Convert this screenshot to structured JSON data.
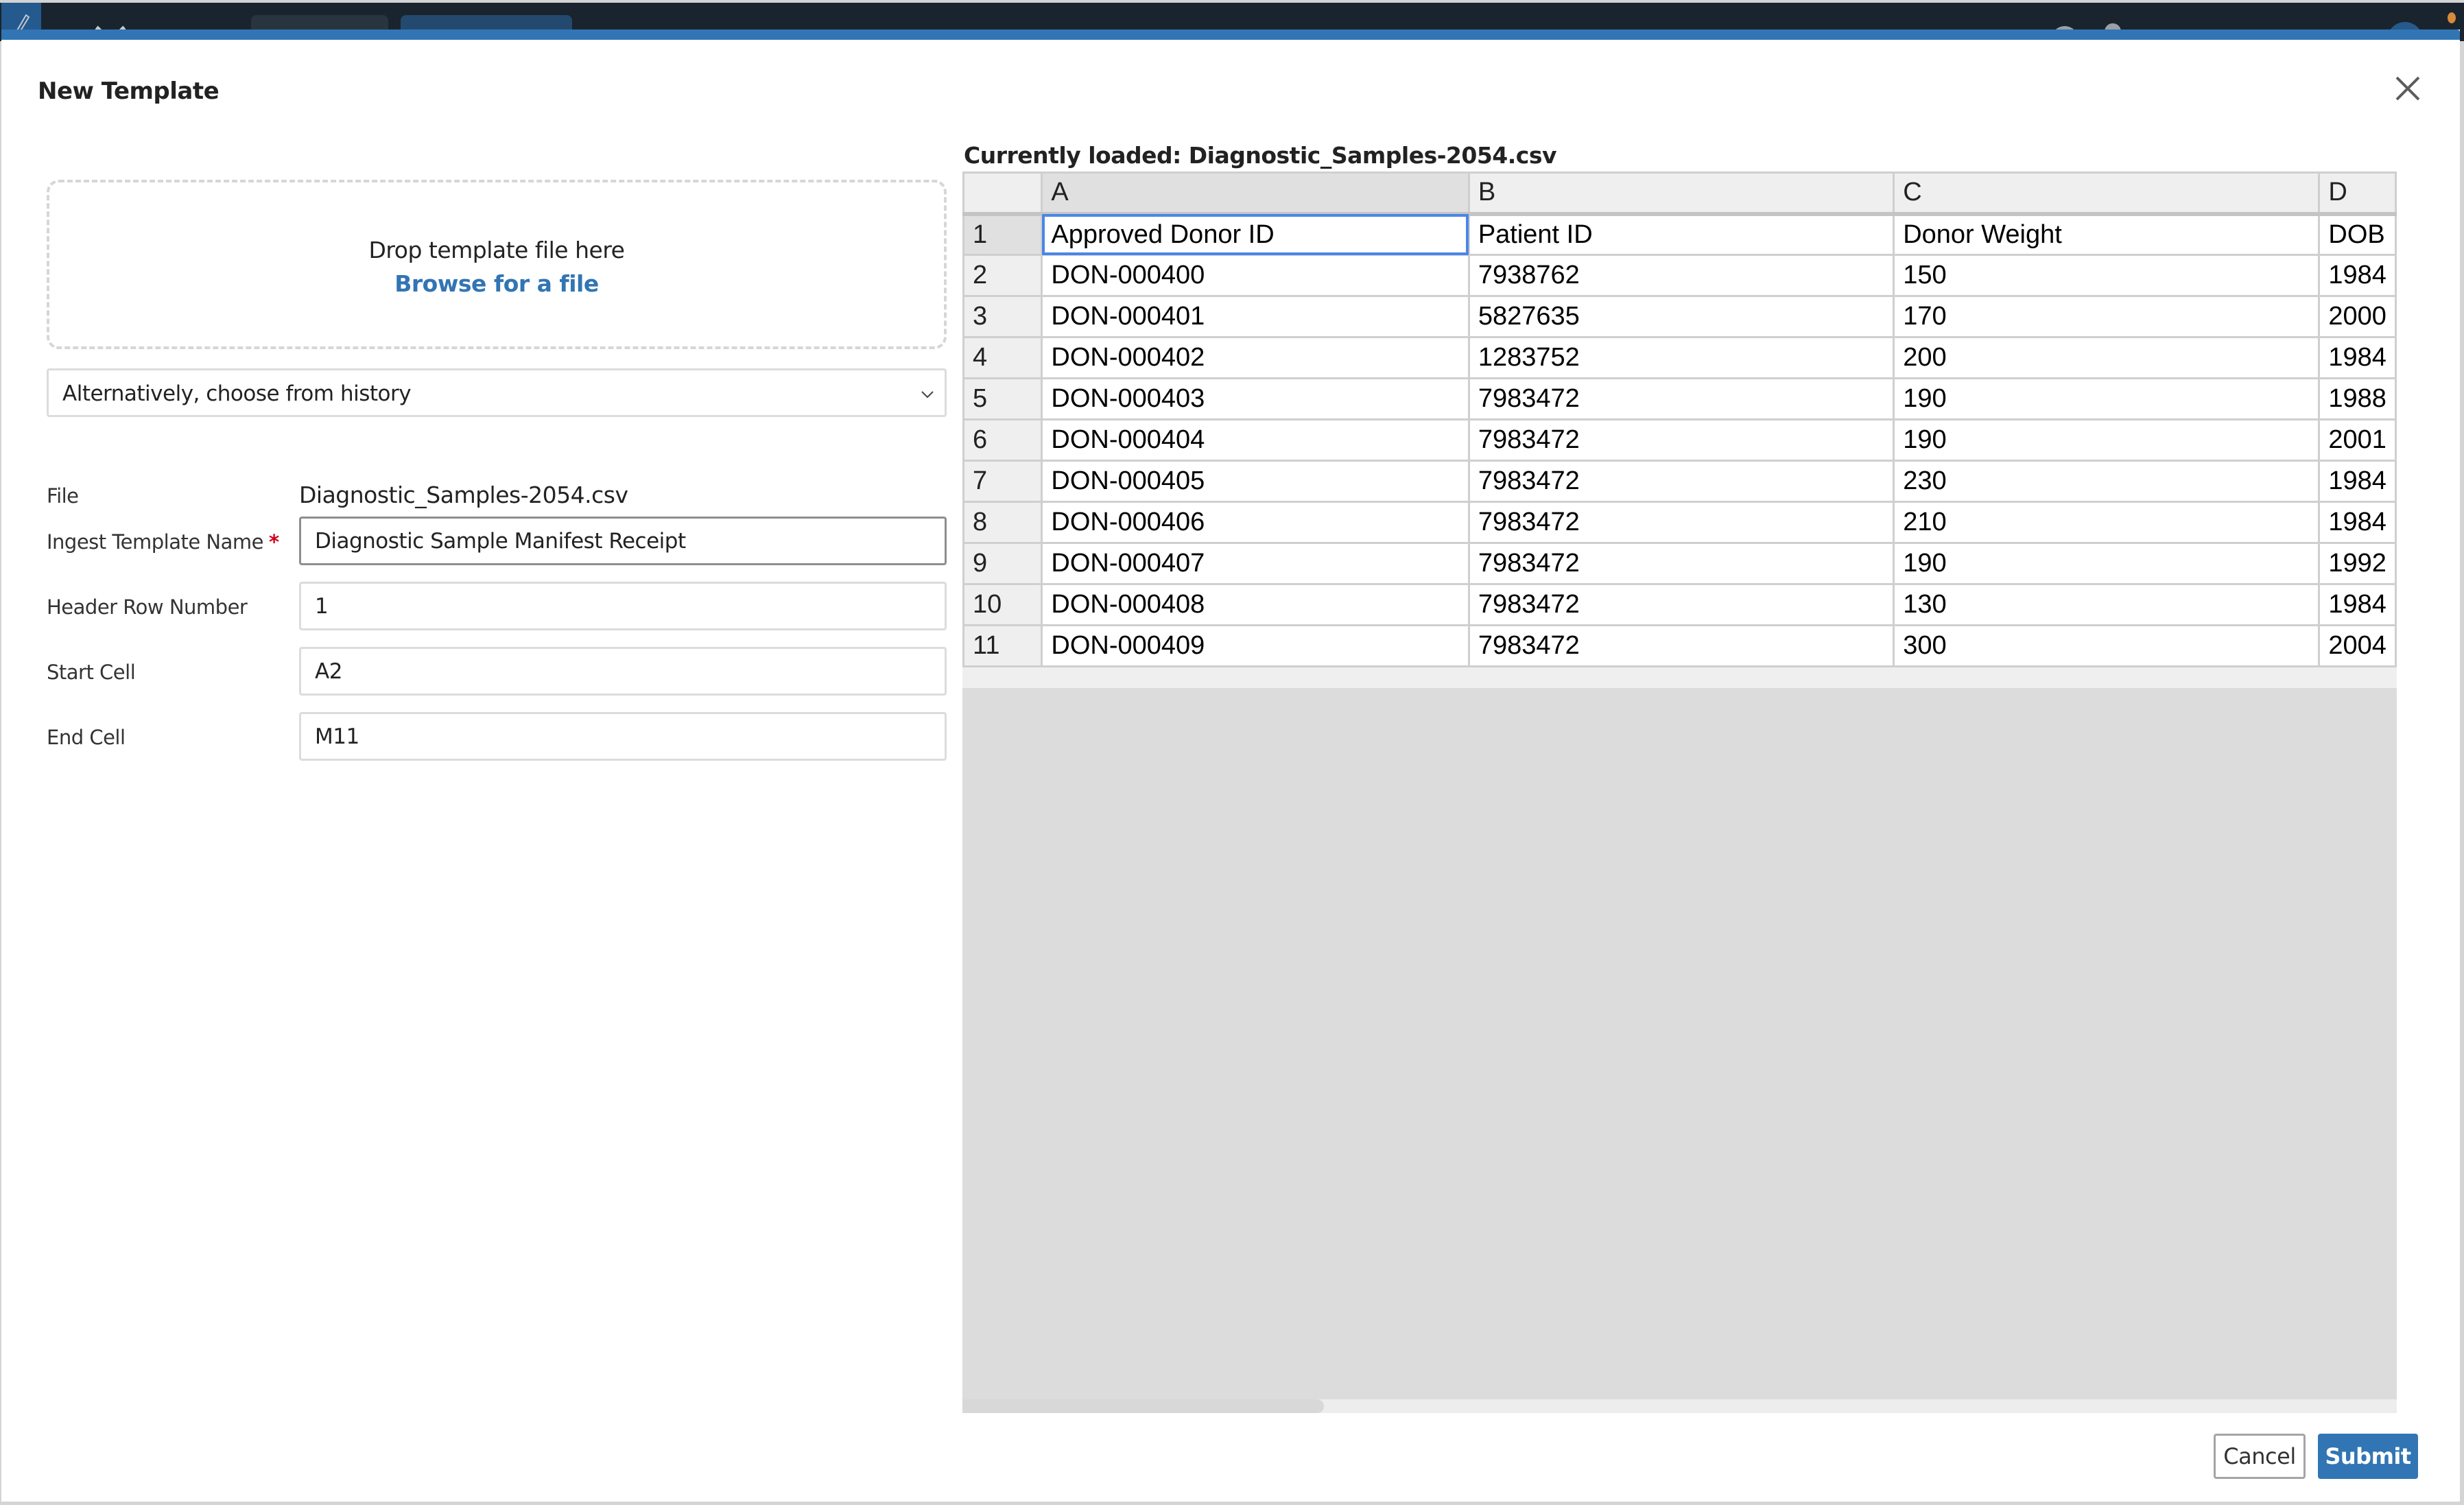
{
  "modal": {
    "title": "New Template",
    "close_icon": "close-icon"
  },
  "dropzone": {
    "prompt": "Drop template file here",
    "browse_link": "Browse for a file"
  },
  "history_select": {
    "selected": "Alternatively, choose from history",
    "icon": "chevron-down-icon"
  },
  "form": {
    "file_label": "File",
    "file_value": "Diagnostic_Samples-2054.csv",
    "template_name_label": "Ingest Template Name",
    "template_name_required": "*",
    "template_name_value": "Diagnostic Sample Manifest Receipt",
    "header_row_label": "Header Row Number",
    "header_row_value": "1",
    "start_cell_label": "Start Cell",
    "start_cell_value": "A2",
    "end_cell_label": "End Cell",
    "end_cell_value": "M11"
  },
  "preview": {
    "loaded_label": "Currently loaded: Diagnostic_Samples-2054.csv",
    "columns": [
      "A",
      "B",
      "C",
      "D"
    ],
    "rows": [
      {
        "num": "1",
        "cells": [
          "Approved Donor ID",
          "Patient ID",
          "Donor Weight",
          "DOB"
        ]
      },
      {
        "num": "2",
        "cells": [
          "DON-000400",
          "7938762",
          "150",
          "1984"
        ]
      },
      {
        "num": "3",
        "cells": [
          "DON-000401",
          "5827635",
          "170",
          "2000"
        ]
      },
      {
        "num": "4",
        "cells": [
          "DON-000402",
          "1283752",
          "200",
          "1984"
        ]
      },
      {
        "num": "5",
        "cells": [
          "DON-000403",
          "7983472",
          "190",
          "1988"
        ]
      },
      {
        "num": "6",
        "cells": [
          "DON-000404",
          "7983472",
          "190",
          "2001"
        ]
      },
      {
        "num": "7",
        "cells": [
          "DON-000405",
          "7983472",
          "230",
          "1984"
        ]
      },
      {
        "num": "8",
        "cells": [
          "DON-000406",
          "7983472",
          "210",
          "1984"
        ]
      },
      {
        "num": "9",
        "cells": [
          "DON-000407",
          "7983472",
          "190",
          "1992"
        ]
      },
      {
        "num": "10",
        "cells": [
          "DON-000408",
          "7983472",
          "130",
          "1984"
        ]
      },
      {
        "num": "11",
        "cells": [
          "DON-000409",
          "7983472",
          "300",
          "2004"
        ]
      }
    ],
    "selected_cell": "A1"
  },
  "footer": {
    "cancel_label": "Cancel",
    "submit_label": "Submit"
  },
  "colors": {
    "accent": "#3275b4",
    "required": "#d0021b",
    "selection": "#4a86e8",
    "appbar": "#19242f"
  }
}
